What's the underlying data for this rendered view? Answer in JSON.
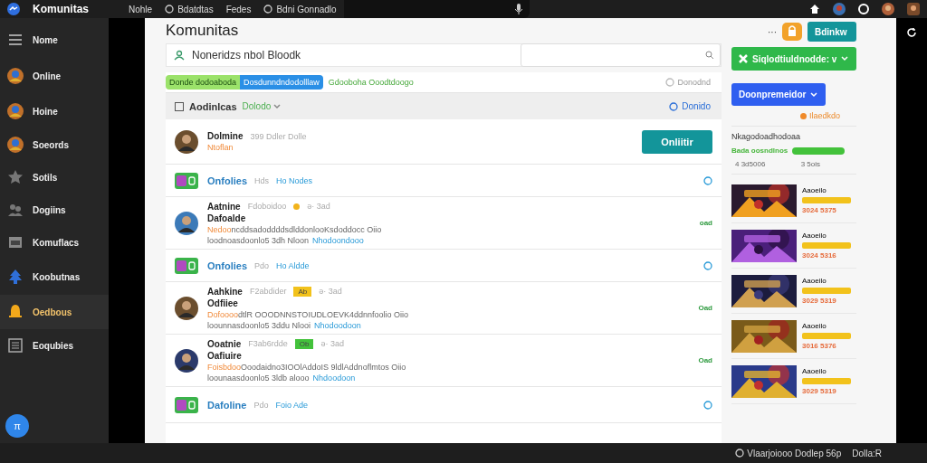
{
  "top_bar": {
    "app_name": "Komunitas",
    "nav": [
      "Nohle",
      "Bdatdtas",
      "Fedes",
      "Bdni Gonnadlo"
    ]
  },
  "sidebar": {
    "items": [
      {
        "label": "Nome",
        "selected": false
      },
      {
        "label": "Online",
        "selected": false
      },
      {
        "label": "Hoine",
        "selected": false
      },
      {
        "label": "Soeords",
        "selected": false
      },
      {
        "label": "Sotils",
        "selected": false
      },
      {
        "label": "Dogiins",
        "selected": false
      },
      {
        "label": "Komuflacs",
        "selected": false
      },
      {
        "label": "Koobutnas",
        "selected": false
      },
      {
        "label": "Oedbous",
        "selected": true
      },
      {
        "label": "Eoqubies",
        "selected": false
      }
    ],
    "fab": "π"
  },
  "page": {
    "title": "Komunitas",
    "search_label": "Noneridzs nbol Bloodk",
    "chips": [
      {
        "label": "Donde dodoaboda",
        "color": "#9be26a"
      },
      {
        "label": "Dosdunndndodolllaw",
        "color": "#2a8fe6"
      }
    ],
    "filter_link": "Gdooboha Ooodtdoogo",
    "sort_label": "Donodnd",
    "list_header": {
      "checked": false,
      "title": "Aodinlcas",
      "filter": "Dolodo",
      "view": "Donido"
    },
    "feed": [
      {
        "kind": "post",
        "name": "Dolmine",
        "meta": "399 Ddler Dolle",
        "sub": "Ntoflan",
        "action": "Onliitir"
      },
      {
        "kind": "link",
        "title": "Onfolies",
        "meta": "Hds",
        "link": "Ho Nodes"
      },
      {
        "kind": "post",
        "name": "Aatnine",
        "name2": "Dafoalde",
        "meta": "Fdoboidoo",
        "tag": {
          "color": "#f2b31b"
        },
        "time": "ə· 3ad",
        "lead": "Nedoo",
        "text": "ncddsadoddddsdlddonlooKsdoddocc Oiio",
        "text2": "loodnoasdoonlo5 3dh Nloon",
        "link": "Nhodoondooo",
        "status": "oad"
      },
      {
        "kind": "link",
        "title": "Onfolies",
        "meta": "Pdo",
        "link": "Ho Aldde"
      },
      {
        "kind": "post",
        "name": "Aahkine",
        "name2": "Odfiiee",
        "meta": "F2abdider",
        "tag": {
          "label": "Ab",
          "color": "#f2c21b"
        },
        "time": "ə· 3ad",
        "lead": "Dofoooo",
        "text": "dtlR OOODNNSTOIUDLOEVK4ddnnfoolio Oiio",
        "text2": "loounnasdoonlo5 3ddu Nlooi",
        "link": "Nhodoodoon",
        "status": "Oad"
      },
      {
        "kind": "post",
        "name": "Ooatnie",
        "name2": "Oafiuire",
        "meta": "F3ab6rdde",
        "tag": {
          "label": "Ob",
          "color": "#43c23b"
        },
        "time": "ə· 3ad",
        "lead": "Foisbdoo",
        "text": "Ooodaidno3IOOlAddoIS 9ldlAddnoflmtos Oiio",
        "text2": "loounaasdoonlo5 3ldb alooo",
        "link": "Nhdoodoon",
        "status": "Oad"
      },
      {
        "kind": "link",
        "title": "Dafoline",
        "meta": "Pdo",
        "link": "Foio Ade"
      }
    ]
  },
  "side": {
    "more": "···",
    "primary": "Bdinkw",
    "green_button": "Siqlodtiuldnodde: v",
    "blue_button": "Doonpremeidor",
    "orange_link": "Ilaedkdo",
    "section_title": "Nkagodoadhodoaa",
    "stat_label": "Bada oosndlnos",
    "stat_a": "4 3d5006",
    "stat_b": "3 5ois",
    "games": [
      {
        "title": "Aaoeilo",
        "number": "3024 5375",
        "kind": "picture"
      },
      {
        "title": "Aaoeilo",
        "number": "3024 5316",
        "kind": "picture"
      },
      {
        "title": "Aaoeilo",
        "number": "3029 5319",
        "kind": "picture"
      },
      {
        "title": "Aaoeilo",
        "number": "3016 5376",
        "kind": "picture"
      },
      {
        "title": "Aaoeilo",
        "number": "3029 5319",
        "kind": "picture"
      }
    ]
  },
  "status_bar": {
    "text": "Vlaarjoiooo Dodlep 56p",
    "extra": "Dolla:R"
  }
}
